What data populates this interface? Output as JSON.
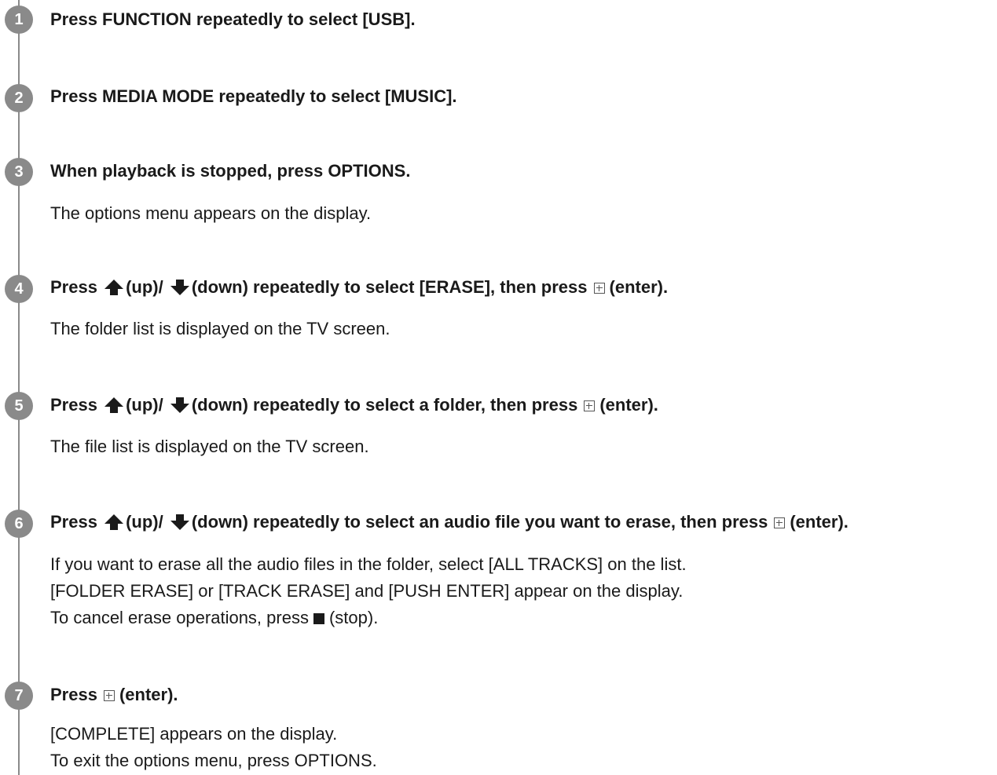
{
  "steps": [
    {
      "number": "1",
      "title": [
        "Press FUNCTION repeatedly to select [USB]."
      ],
      "desc": []
    },
    {
      "number": "2",
      "title": [
        "Press MEDIA MODE repeatedly to select [MUSIC]."
      ],
      "desc": []
    },
    {
      "number": "3",
      "title": [
        "When playback is stopped, press OPTIONS."
      ],
      "desc": [
        "The options menu appears on the display."
      ]
    },
    {
      "number": "4",
      "title": [
        "Press",
        "(up)/",
        "(down) repeatedly to select [ERASE], then press",
        "(enter)."
      ],
      "desc": [
        "The folder list is displayed on the TV screen."
      ]
    },
    {
      "number": "5",
      "title": [
        "Press",
        "(up)/",
        "(down) repeatedly to select a folder, then press",
        "(enter)."
      ],
      "desc": [
        "The file list is displayed on the TV screen."
      ]
    },
    {
      "number": "6",
      "title": [
        "Press",
        "(up)/",
        "(down) repeatedly to select an audio file you want to erase, then press",
        "(enter)."
      ],
      "desc": [
        "If you want to erase all the audio files in the folder, select [ALL TRACKS] on the list.",
        "[FOLDER ERASE] or [TRACK ERASE] and [PUSH ENTER] appear on the display.",
        "To cancel erase operations, press",
        "(stop)."
      ]
    },
    {
      "number": "7",
      "title": [
        "Press",
        "(enter)."
      ],
      "desc": [
        "[COMPLETE] appears on the display.",
        "To exit the options menu, press OPTIONS."
      ]
    }
  ],
  "icons": {
    "up": "arrow-up-icon",
    "down": "arrow-down-icon",
    "enter": "enter-button-icon",
    "stop": "stop-icon"
  },
  "colors": {
    "badge": "#8a8a8a",
    "text": "#1a1a1a",
    "rail": "#8a8a8a"
  }
}
